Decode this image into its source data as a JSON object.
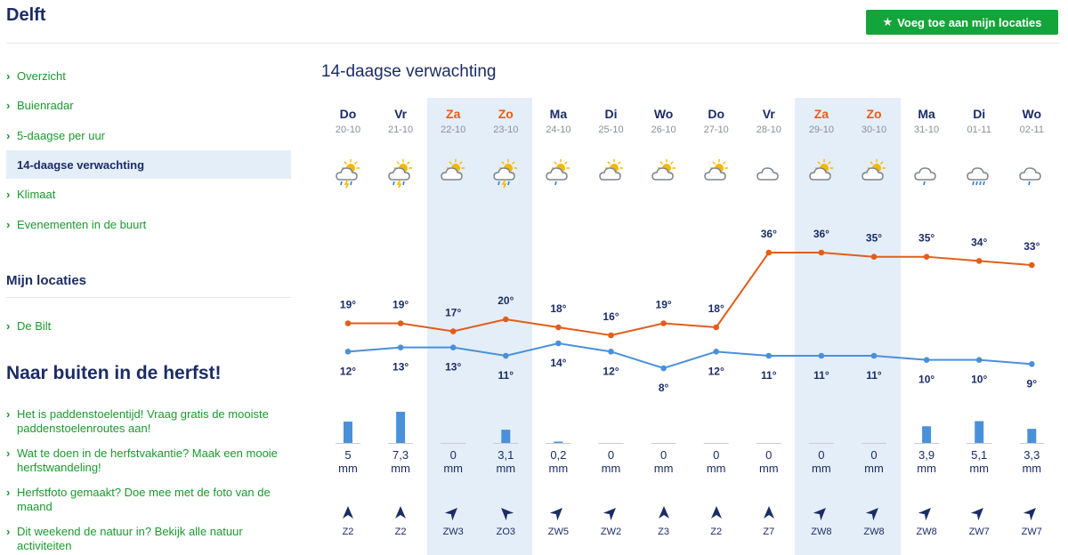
{
  "header": {
    "city": "Delft",
    "add_button": "Voeg toe aan mijn locaties"
  },
  "sidebar": {
    "nav": [
      {
        "label": "Overzicht",
        "active": false
      },
      {
        "label": "Buienradar",
        "active": false
      },
      {
        "label": "5-daagse per uur",
        "active": false
      },
      {
        "label": "14-daagse verwachting",
        "active": true
      },
      {
        "label": "Klimaat",
        "active": false
      },
      {
        "label": "Evenementen in de buurt",
        "active": false
      }
    ],
    "my_locations_title": "Mijn locaties",
    "my_locations": [
      "De Bilt"
    ],
    "outdoor_title": "Naar buiten in de herfst!",
    "articles": [
      "Het is paddenstoelentijd! Vraag gratis de mooiste paddenstoelenroutes aan!",
      "Wat te doen in de herfstvakantie? Maak een mooie herfstwandeling!",
      "Herfstfoto gemaakt? Doe mee met de foto van de maand",
      "Dit weekend de natuur in? Bekijk alle natuur activiteiten"
    ]
  },
  "forecast": {
    "title": "14-daagse verwachting",
    "precip_unit": "mm",
    "days": [
      {
        "day": "Do",
        "date": "20-10",
        "weekend": false,
        "icon": "thunderstorm-sun-icon",
        "max": "19°",
        "min": "12°",
        "precip": "5",
        "wind": "Z2"
      },
      {
        "day": "Vr",
        "date": "21-10",
        "weekend": false,
        "icon": "thunderstorm-sun-icon",
        "max": "19°",
        "min": "13°",
        "precip": "7,3",
        "wind": "Z2"
      },
      {
        "day": "Za",
        "date": "22-10",
        "weekend": true,
        "icon": "partly-cloudy-icon",
        "max": "17°",
        "min": "13°",
        "precip": "0",
        "wind": "ZW3"
      },
      {
        "day": "Zo",
        "date": "23-10",
        "weekend": true,
        "icon": "thunderstorm-sun-icon",
        "max": "20°",
        "min": "11°",
        "precip": "3,1",
        "wind": "ZO3"
      },
      {
        "day": "Ma",
        "date": "24-10",
        "weekend": false,
        "icon": "light-rain-sun-icon",
        "max": "18°",
        "min": "14°",
        "precip": "0,2",
        "wind": "ZW5"
      },
      {
        "day": "Di",
        "date": "25-10",
        "weekend": false,
        "icon": "partly-cloudy-icon",
        "max": "16°",
        "min": "12°",
        "precip": "0",
        "wind": "ZW2"
      },
      {
        "day": "Wo",
        "date": "26-10",
        "weekend": false,
        "icon": "partly-cloudy-icon",
        "max": "19°",
        "min": "8°",
        "precip": "0",
        "wind": "Z3"
      },
      {
        "day": "Do",
        "date": "27-10",
        "weekend": false,
        "icon": "partly-cloudy-icon",
        "max": "18°",
        "min": "12°",
        "precip": "0",
        "wind": "Z2"
      },
      {
        "day": "Vr",
        "date": "28-10",
        "weekend": false,
        "icon": "cloudy-icon",
        "max": "36°",
        "min": "11°",
        "precip": "0",
        "wind": "Z7"
      },
      {
        "day": "Za",
        "date": "29-10",
        "weekend": true,
        "icon": "partly-cloudy-icon",
        "max": "36°",
        "min": "11°",
        "precip": "0",
        "wind": "ZW8"
      },
      {
        "day": "Zo",
        "date": "30-10",
        "weekend": true,
        "icon": "partly-cloudy-icon",
        "max": "35°",
        "min": "11°",
        "precip": "0",
        "wind": "ZW8"
      },
      {
        "day": "Ma",
        "date": "31-10",
        "weekend": false,
        "icon": "light-rain-icon",
        "max": "35°",
        "min": "10°",
        "precip": "3,9",
        "wind": "ZW8"
      },
      {
        "day": "Di",
        "date": "01-11",
        "weekend": false,
        "icon": "rain-icon",
        "max": "34°",
        "min": "10°",
        "precip": "5,1",
        "wind": "ZW7"
      },
      {
        "day": "Wo",
        "date": "02-11",
        "weekend": false,
        "icon": "light-rain-icon",
        "max": "33°",
        "min": "9°",
        "precip": "3,3",
        "wind": "ZW7"
      }
    ]
  },
  "chart_data": {
    "type": "line",
    "x": [
      "20-10",
      "21-10",
      "22-10",
      "23-10",
      "24-10",
      "25-10",
      "26-10",
      "27-10",
      "28-10",
      "29-10",
      "30-10",
      "31-10",
      "01-11",
      "02-11"
    ],
    "series": [
      {
        "values": [
          19,
          19,
          17,
          20,
          18,
          16,
          19,
          18,
          36,
          36,
          35,
          35,
          34,
          33
        ],
        "color": "#e35d1a"
      },
      {
        "values": [
          12,
          13,
          13,
          11,
          14,
          12,
          8,
          12,
          11,
          11,
          11,
          10,
          10,
          9
        ],
        "color": "#4a90d9"
      }
    ],
    "precipitation_mm": [
      5,
      7.3,
      0,
      3.1,
      0.2,
      0,
      0,
      0,
      0,
      0,
      0,
      3.9,
      5.1,
      3.3
    ],
    "wind_rotation_deg": [
      0,
      0,
      45,
      -45,
      45,
      45,
      0,
      0,
      0,
      45,
      45,
      45,
      45,
      45
    ]
  },
  "colors": {
    "accent_green": "#14a53a",
    "weekend_orange": "#e35d1a",
    "navy": "#1b2c66",
    "min_line": "#4a90d9",
    "weekend_bg": "#e4eef8"
  }
}
